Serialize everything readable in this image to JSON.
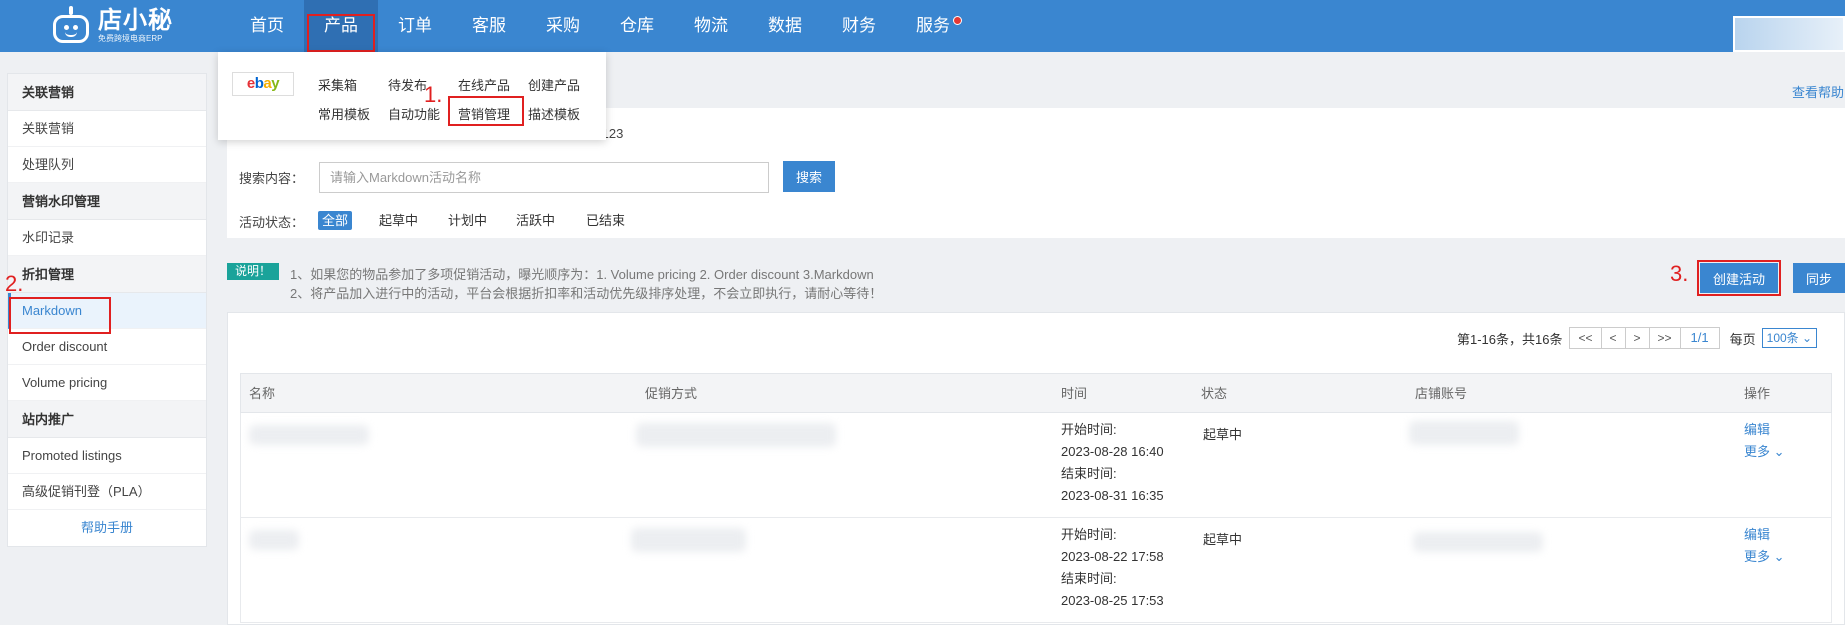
{
  "brand": {
    "name": "店小秘",
    "tagline": "免费跨境电商ERP"
  },
  "nav": {
    "items": [
      "首页",
      "产品",
      "订单",
      "客服",
      "采购",
      "仓库",
      "物流",
      "数据",
      "财务",
      "服务"
    ]
  },
  "dropdown": {
    "row1": [
      "采集箱",
      "待发布",
      "在线产品",
      "创建产品"
    ],
    "row2": [
      "常用模板",
      "自动功能",
      "营销管理",
      "描述模板"
    ]
  },
  "annotations": {
    "step1": "1.",
    "step2": "2.",
    "step3": "3."
  },
  "sidebar": {
    "g1": "关联营销",
    "g1_items": [
      "关联营销",
      "处理队列"
    ],
    "g2": "营销水印管理",
    "g2_items": [
      "水印记录"
    ],
    "g3": "折扣管理",
    "g3_items": [
      "Markdown",
      "Order discount",
      "Volume pricing"
    ],
    "g4": "站内推广",
    "g4_items": [
      "Promoted listings",
      "高级促销刊登（PLA）"
    ],
    "help": "帮助手册"
  },
  "help_link": "查看帮助",
  "filter": {
    "account_tail": ":123",
    "search_label": "搜索内容：",
    "search_placeholder": "请输入Markdown活动名称",
    "search_button": "搜索",
    "status_label": "活动状态：",
    "status_options": [
      "全部",
      "起草中",
      "计划中",
      "活跃中",
      "已结束"
    ]
  },
  "notice": {
    "badge": "说明！",
    "line1": "1、如果您的物品参加了多项促销活动，曝光顺序为：1. Volume pricing 2. Order discount 3.Markdown",
    "line2": "2、将产品加入进行中的活动，平台会根据折扣率和活动优先级排序处理，不会立即执行，请耐心等待！"
  },
  "actions": {
    "create": "创建活动",
    "sync": "同步"
  },
  "pager": {
    "summary": "第1-16条，共16条",
    "first": "<<",
    "prev": "<",
    "next": ">",
    "last": ">>",
    "current": "1/1",
    "per_label": "每页",
    "per_value": "100条"
  },
  "table": {
    "headers": [
      "名称",
      "促销方式",
      "时间",
      "状态",
      "店铺账号",
      "操作"
    ],
    "rows": [
      {
        "start_label": "开始时间:",
        "start": "2023-08-28 16:40",
        "end_label": "结束时间:",
        "end": "2023-08-31 16:35",
        "status": "起草中",
        "edit": "编辑",
        "more": "更多"
      },
      {
        "start_label": "开始时间:",
        "start": "2023-08-22 17:58",
        "end_label": "结束时间:",
        "end": "2023-08-25 17:53",
        "status": "起草中",
        "edit": "编辑",
        "more": "更多"
      }
    ]
  },
  "colors": {
    "primary": "#3a86d0",
    "highlight": "#e02020",
    "badge": "#1aa39a"
  }
}
